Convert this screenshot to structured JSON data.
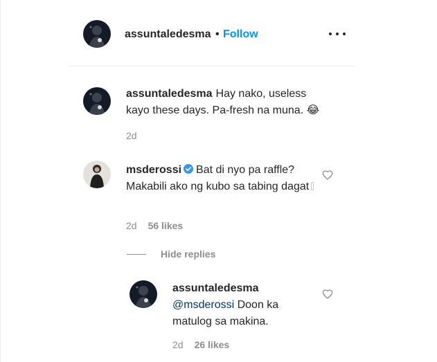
{
  "post": {
    "username": "assuntaledesma",
    "separator": "•",
    "follow_label": "Follow",
    "more_icon": "more-horizontal-icon"
  },
  "comments": [
    {
      "username": "assuntaledesma",
      "text": "Hay nako, useless kayo these days. Pa-fresh na muna. 😂",
      "time": "2d"
    },
    {
      "username": "msderossi",
      "verified": true,
      "text": "Bat di nyo pa raffle? Makabili ako ng kubo sa tabing dagat",
      "time": "2d",
      "likes": "56 likes"
    }
  ],
  "hide_replies_label": "Hide replies",
  "replies": [
    {
      "username": "assuntaledesma",
      "mention": "@msderossi",
      "text": " Doon ka matulog sa makina.",
      "time": "2d",
      "likes": "26 likes"
    }
  ],
  "colors": {
    "link": "#0095f6",
    "mention": "#00376b",
    "verified": "#3897f0",
    "muted": "#8e8e8e"
  }
}
